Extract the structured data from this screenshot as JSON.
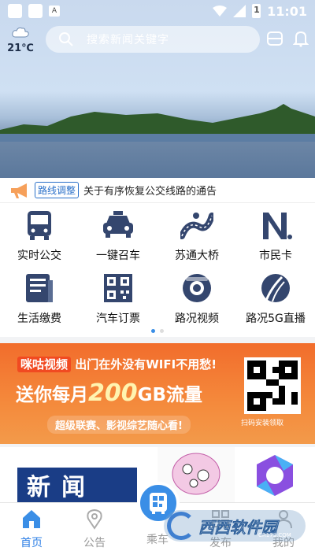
{
  "status_bar": {
    "time": "11:01",
    "battery_level": "1",
    "app_badge": "A"
  },
  "weather": {
    "temperature": "21℃",
    "icon": "cloud-icon"
  },
  "search": {
    "placeholder": "搜索新闻关键字"
  },
  "notice": {
    "tag": "路线调整",
    "text": "关于有序恢复公交线路的通告"
  },
  "grid": {
    "items": [
      {
        "label": "实时公交",
        "icon": "bus-icon"
      },
      {
        "label": "一键召车",
        "icon": "taxi-icon"
      },
      {
        "label": "苏通大桥",
        "icon": "bridge-icon"
      },
      {
        "label": "市民卡",
        "icon": "citizen-card-icon"
      },
      {
        "label": "生活缴费",
        "icon": "bill-icon"
      },
      {
        "label": "汽车订票",
        "icon": "ticket-qr-icon"
      },
      {
        "label": "路况视频",
        "icon": "camera-icon"
      },
      {
        "label": "路况5G直播",
        "icon": "road-live-icon"
      }
    ],
    "page_count": 2,
    "active_page": 1
  },
  "banner": {
    "brand": "咪咕视频",
    "headline": "出门在外没有WIFI不用愁!",
    "offer_prefix": "送你每月",
    "offer_amount": "200",
    "offer_suffix": "GB流量",
    "slogan": "超级联赛、影视综艺随心看!",
    "qr_caption": "扫码安装领取"
  },
  "cards": {
    "news_title": "新闻"
  },
  "tabbar": {
    "tabs": [
      {
        "label": "首页",
        "icon": "home-icon",
        "active": true
      },
      {
        "label": "公告",
        "icon": "location-icon",
        "active": false
      },
      {
        "label": "乘车",
        "icon": "bus-qr-icon",
        "active": false
      },
      {
        "label": "发布",
        "icon": "grid-icon",
        "active": false
      },
      {
        "label": "我的",
        "icon": "user-icon",
        "active": false
      }
    ]
  },
  "watermark": {
    "text": "西西软件园",
    "sub": "CR173.COM"
  },
  "colors": {
    "accent": "#3a8ee6",
    "banner": "#f26d2c",
    "icon_navy": "#34466e"
  }
}
